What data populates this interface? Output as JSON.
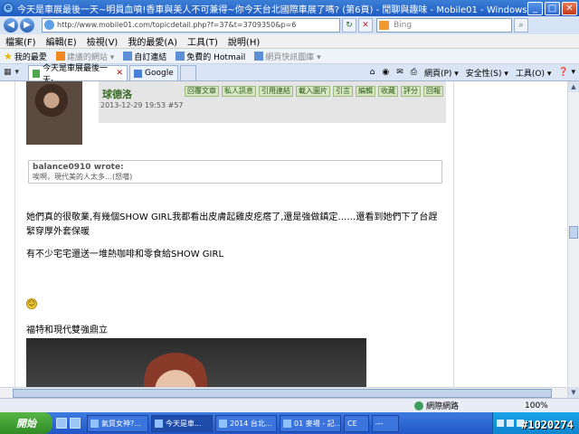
{
  "window": {
    "title": "今天是車展最後一天~明員血噴!香車與美人不可兼得~你今天台北國際車展了嗎? (第6頁) - 閒聊與趣味 - Mobile01 - Windows Internet Explorer",
    "minimize": "_",
    "maximize": "□",
    "close": "✕"
  },
  "address": {
    "url": "http://www.mobile01.com/topicdetail.php?f=37&t=3709350&p=6",
    "search_placeholder": "Bing"
  },
  "menu": [
    "檔案(F)",
    "編輯(E)",
    "檢視(V)",
    "我的最愛(A)",
    "工具(T)",
    "說明(H)"
  ],
  "favorites": {
    "label": "我的最愛",
    "items": [
      {
        "label": "建議的網站 ▾",
        "dim": true
      },
      {
        "label": "自訂連結",
        "dim": false
      },
      {
        "label": "免費的 Hotmail",
        "dim": false
      },
      {
        "label": "網頁快訊圖庫 ▾",
        "dim": true
      }
    ]
  },
  "tabs": [
    {
      "label": "今天是車展最後一天-...",
      "active": true
    },
    {
      "label": "Google",
      "active": false
    }
  ],
  "commands": [
    "網頁(P) ▾",
    "安全性(S) ▾",
    "工具(O) ▾",
    "❓ ▾"
  ],
  "post": {
    "author": "球德洛",
    "meta": "2013-12-29 19:53 #57",
    "actions": [
      "回覆文章",
      "私人訊息",
      "引用連結",
      "載入圖片",
      "引言",
      "編輯",
      "收藏",
      "評分",
      "回報"
    ],
    "quote_author": "balance0910 wrote:",
    "quote_text": "唉啊，現代美的人太多…(怒噹)",
    "paragraph1": "她們真的很敬業,有幾個SHOW GIRL我都看出皮膚起雞皮疙瘩了,還是強做鎮定……還看到她們下了台趕緊穿厚外套保暖",
    "paragraph2": "有不少宅宅還送一堆熱咖啡和零食給SHOW GIRL",
    "emoji": "☺",
    "caption": "福特和現代雙強鼎立"
  },
  "status": {
    "zone": "網際網路",
    "zoom": "100%"
  },
  "taskbar": {
    "start": "開始",
    "tasks": [
      {
        "label": "氣質女神?...",
        "active": false
      },
      {
        "label": "今天是車...",
        "active": true
      },
      {
        "label": "2014 台北...",
        "active": false
      },
      {
        "label": "01 麥場 - 記...",
        "active": false
      },
      {
        "label": "CE",
        "active": false
      },
      {
        "label": "---",
        "active": false
      }
    ]
  },
  "watermark": "#1020274"
}
